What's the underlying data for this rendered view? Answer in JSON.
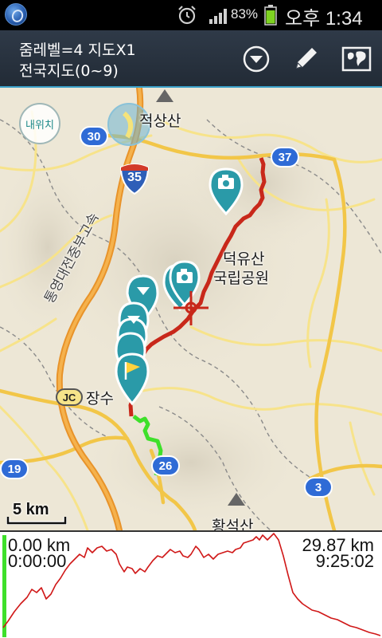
{
  "status_bar": {
    "battery_percent": "83%",
    "time": "오후 1:34",
    "icons": [
      "app-icon",
      "alarm-icon",
      "signal-icon",
      "battery-icon"
    ]
  },
  "action_bar": {
    "zoom_line1": "줌레벨=4 지도X1",
    "zoom_line2": "전국지도(0~9)",
    "buttons": [
      "dropdown-icon",
      "pencil-icon",
      "map-icon"
    ]
  },
  "map": {
    "my_location_label": "내위치",
    "places": {
      "jeoksangsan": "적상산",
      "deogyusan_1": "덕유산",
      "deogyusan_2": "국립공원",
      "jangsu": "장수",
      "hwangseoksan": "황석산",
      "expressway": "통영대전중부고속"
    },
    "route_numbers": {
      "r30": "30",
      "r37": "37",
      "r19": "19",
      "r26": "26",
      "r3": "3",
      "hw35": "35"
    },
    "jc_label": "JC",
    "scale_label": "5 km"
  },
  "profile": {
    "start_distance": "0.00 km",
    "start_time": "0:00:00",
    "total_distance": "29.87 km",
    "total_time": "9:25:02"
  },
  "colors": {
    "track_red": "#c8281a",
    "track_green": "#3ee02a",
    "route_badge": "#2f6bd6",
    "marker_teal": "#2a9aa8",
    "action_bar": "#2a3440"
  }
}
